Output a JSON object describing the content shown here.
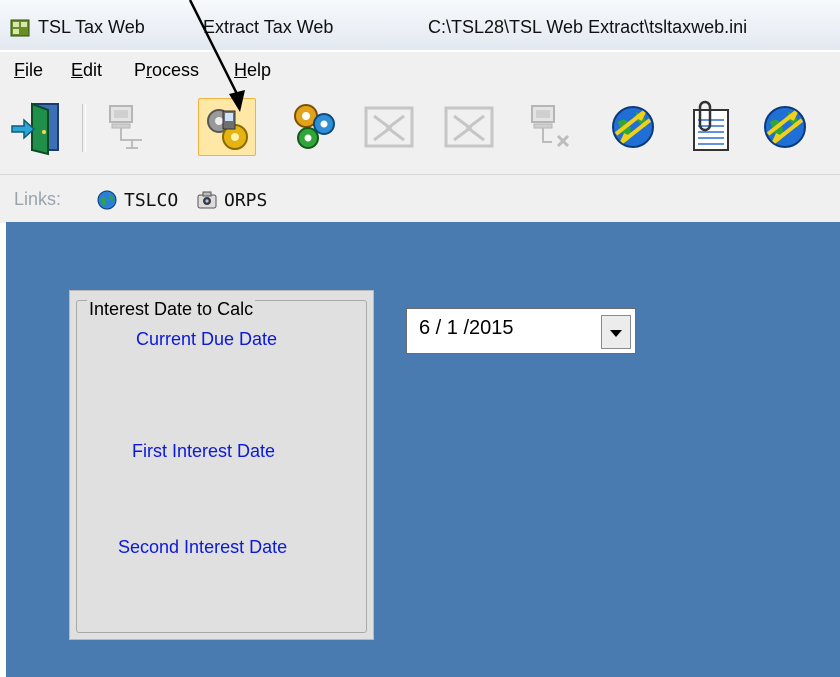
{
  "window": {
    "app_title": "TSL Tax Web",
    "document_title": "Extract Tax Web",
    "file_path": "C:\\TSL28\\TSL Web Extract\\tsltaxweb.ini"
  },
  "menu": {
    "items": [
      {
        "accel": "F",
        "rest": "ile"
      },
      {
        "accel": "E",
        "rest": "dit"
      },
      {
        "pre": "P",
        "accel": "r",
        "rest": "ocess"
      },
      {
        "accel": "H",
        "rest": "elp"
      }
    ]
  },
  "toolbar": {
    "buttons": [
      {
        "icon": "exit-door-icon",
        "enabled": true
      },
      {
        "icon": "network-computer-icon",
        "enabled": false
      },
      {
        "icon": "gears-computer-icon",
        "enabled": true,
        "highlighted": true
      },
      {
        "icon": "gears-icon",
        "enabled": true
      },
      {
        "icon": "transfer-icon",
        "enabled": false
      },
      {
        "icon": "transfer-icon",
        "enabled": false
      },
      {
        "icon": "network-disconnect-icon",
        "enabled": false
      },
      {
        "icon": "globe-arrows-icon",
        "enabled": true
      },
      {
        "icon": "binder-clip-icon",
        "enabled": true
      },
      {
        "icon": "globe-arrows-icon",
        "enabled": true
      }
    ]
  },
  "links": {
    "label": "Links:",
    "items": [
      {
        "label": "TSLCO",
        "icon": "globe-icon"
      },
      {
        "label": "ORPS",
        "icon": "camera-icon"
      }
    ]
  },
  "panel": {
    "group_title": "Interest Date to Calc",
    "labels": {
      "current_due": "Current Due Date",
      "first_interest": "First Interest Date",
      "second_interest": "Second Interest Date"
    }
  },
  "date_combo": {
    "value": "6 / 1 /2015"
  },
  "colors": {
    "client_background": "#4a7bb0",
    "label_blue": "#0b19d8",
    "highlight_button": "#ffe7a6"
  }
}
